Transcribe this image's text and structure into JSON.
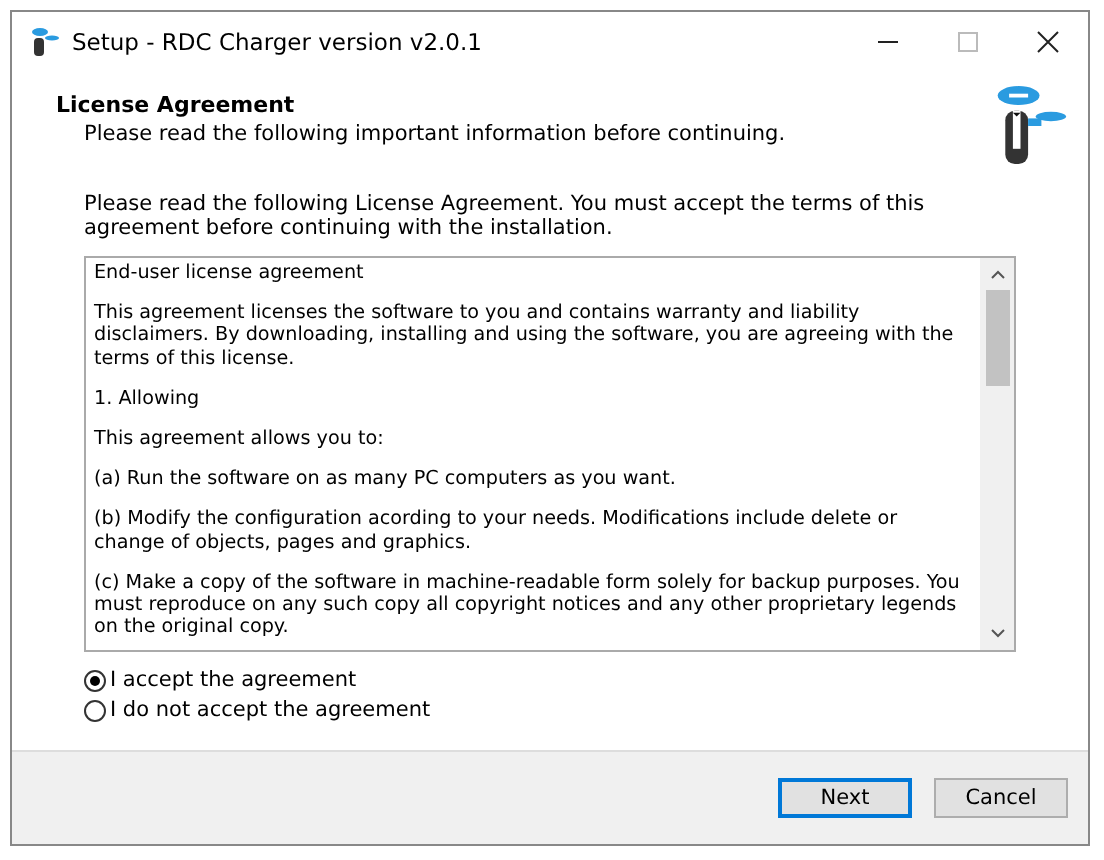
{
  "window": {
    "title": "Setup - RDC Charger version v2.0.1"
  },
  "header": {
    "title": "License Agreement",
    "subtitle": "Please read the following important information before continuing."
  },
  "intro": "Please read the following License Agreement. You must accept the terms of this agreement before continuing with the installation.",
  "license_text": [
    "End-user license agreement",
    "This agreement licenses the software to you and contains warranty and liability disclaimers. By downloading, installing and using the software, you are agreeing with the terms of this license.",
    "1. Allowing",
    "This agreement allows you to:",
    "(a) Run the software on as many PC computers as you want.",
    "(b) Modify the configuration acording to your needs. Modifications include delete or change of objects, pages and graphics.",
    "(c) Make a copy of the software in machine-readable form solely for backup purposes. You must reproduce on any such copy all copyright notices and any other proprietary legends on the original copy."
  ],
  "options": [
    {
      "label": "I accept the agreement",
      "selected": true
    },
    {
      "label": "I do not accept the agreement",
      "selected": false
    }
  ],
  "buttons": [
    {
      "label": "Next",
      "default": true
    },
    {
      "label": "Cancel",
      "default": false
    }
  ]
}
